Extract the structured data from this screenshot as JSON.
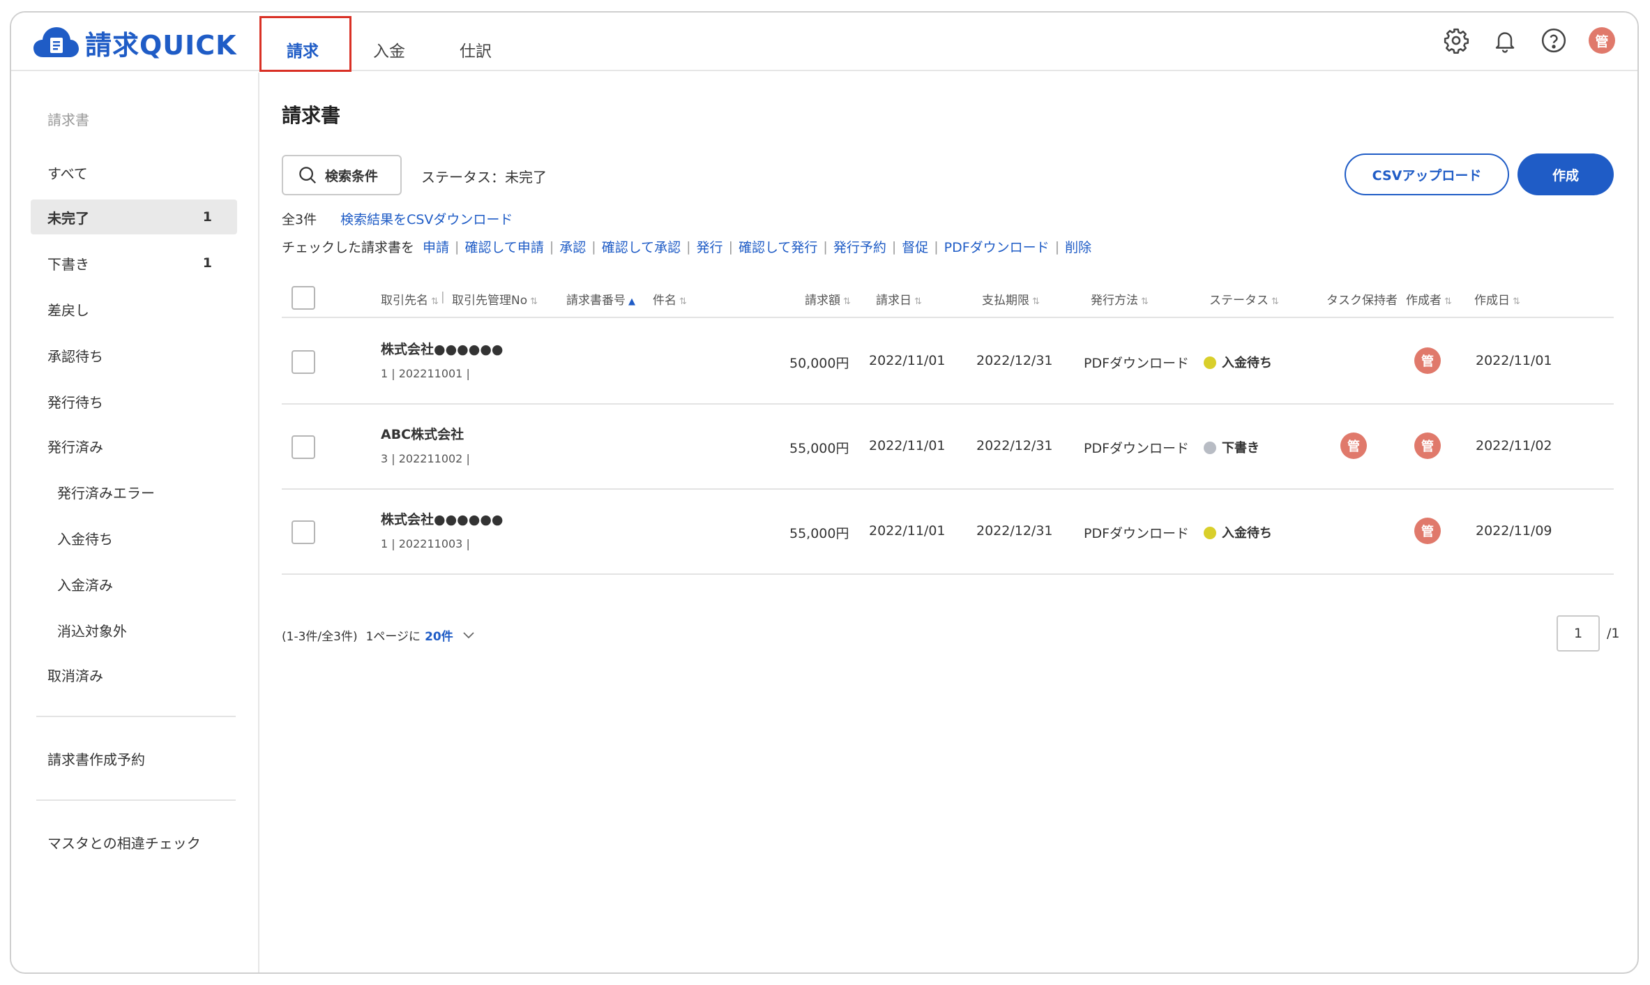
{
  "app": {
    "logo_text": "請求QUICK"
  },
  "tabs": [
    {
      "label": "請求"
    },
    {
      "label": "入金"
    },
    {
      "label": "仕訳"
    }
  ],
  "header": {
    "avatar_text": "管"
  },
  "sidebar": {
    "heading": "請求書",
    "items": [
      {
        "label": "すべて",
        "count": ""
      },
      {
        "label": "未完了",
        "count": "1"
      },
      {
        "label": "下書き",
        "count": "1"
      },
      {
        "label": "差戻し",
        "count": ""
      },
      {
        "label": "承認待ち",
        "count": ""
      },
      {
        "label": "発行待ち",
        "count": ""
      },
      {
        "label": "発行済み",
        "count": ""
      },
      {
        "label": "発行済みエラー",
        "count": ""
      },
      {
        "label": "入金待ち",
        "count": ""
      },
      {
        "label": "入金済み",
        "count": ""
      },
      {
        "label": "消込対象外",
        "count": ""
      },
      {
        "label": "取消済み",
        "count": ""
      }
    ],
    "reserve": "請求書作成予約",
    "master_check": "マスタとの相違チェック"
  },
  "main": {
    "title": "請求書",
    "search_button": "検索条件",
    "status_filter": "ステータス：未完了",
    "csv_upload": "CSVアップロード",
    "create": "作成",
    "total": "全3件",
    "csv_download": "検索結果をCSVダウンロード",
    "bulk_prefix": "チェックした請求書を",
    "bulk_actions": [
      "申請",
      "確認して申請",
      "承認",
      "確認して承認",
      "発行",
      "確認して発行",
      "発行予約",
      "督促",
      "PDFダウンロード",
      "削除"
    ]
  },
  "table": {
    "headers": {
      "partner": "取引先名",
      "partner_no": "取引先管理No",
      "invoice_no": "請求書番号",
      "subject": "件名",
      "amount": "請求額",
      "date": "請求日",
      "due": "支払期限",
      "method": "発行方法",
      "status": "ステータス",
      "task_holder": "タスク保持者",
      "creator": "作成者",
      "created": "作成日"
    },
    "rows": [
      {
        "partner": "株式会社●●●●●●",
        "sub": "1 | 202211001 |",
        "amount": "50,000円",
        "date": "2022/11/01",
        "due": "2022/12/31",
        "method": "PDFダウンロード",
        "status": "入金待ち",
        "status_color": "#d9cf2b",
        "task_holder": "",
        "creator": "管",
        "created": "2022/11/01"
      },
      {
        "partner": "ABC株式会社",
        "sub": "3 | 202211002 |",
        "amount": "55,000円",
        "date": "2022/11/01",
        "due": "2022/12/31",
        "method": "PDFダウンロード",
        "status": "下書き",
        "status_color": "#b8bcc4",
        "task_holder": "管",
        "creator": "管",
        "created": "2022/11/02"
      },
      {
        "partner": "株式会社●●●●●●",
        "sub": "1 | 202211003 |",
        "amount": "55,000円",
        "date": "2022/11/01",
        "due": "2022/12/31",
        "method": "PDFダウンロード",
        "status": "入金待ち",
        "status_color": "#d9cf2b",
        "task_holder": "",
        "creator": "管",
        "created": "2022/11/09"
      }
    ]
  },
  "pager": {
    "range": "(1-3件/全3件)",
    "per_page_label": "1ページに",
    "per_page": "20件",
    "page": "1",
    "total_pages": "/1"
  }
}
